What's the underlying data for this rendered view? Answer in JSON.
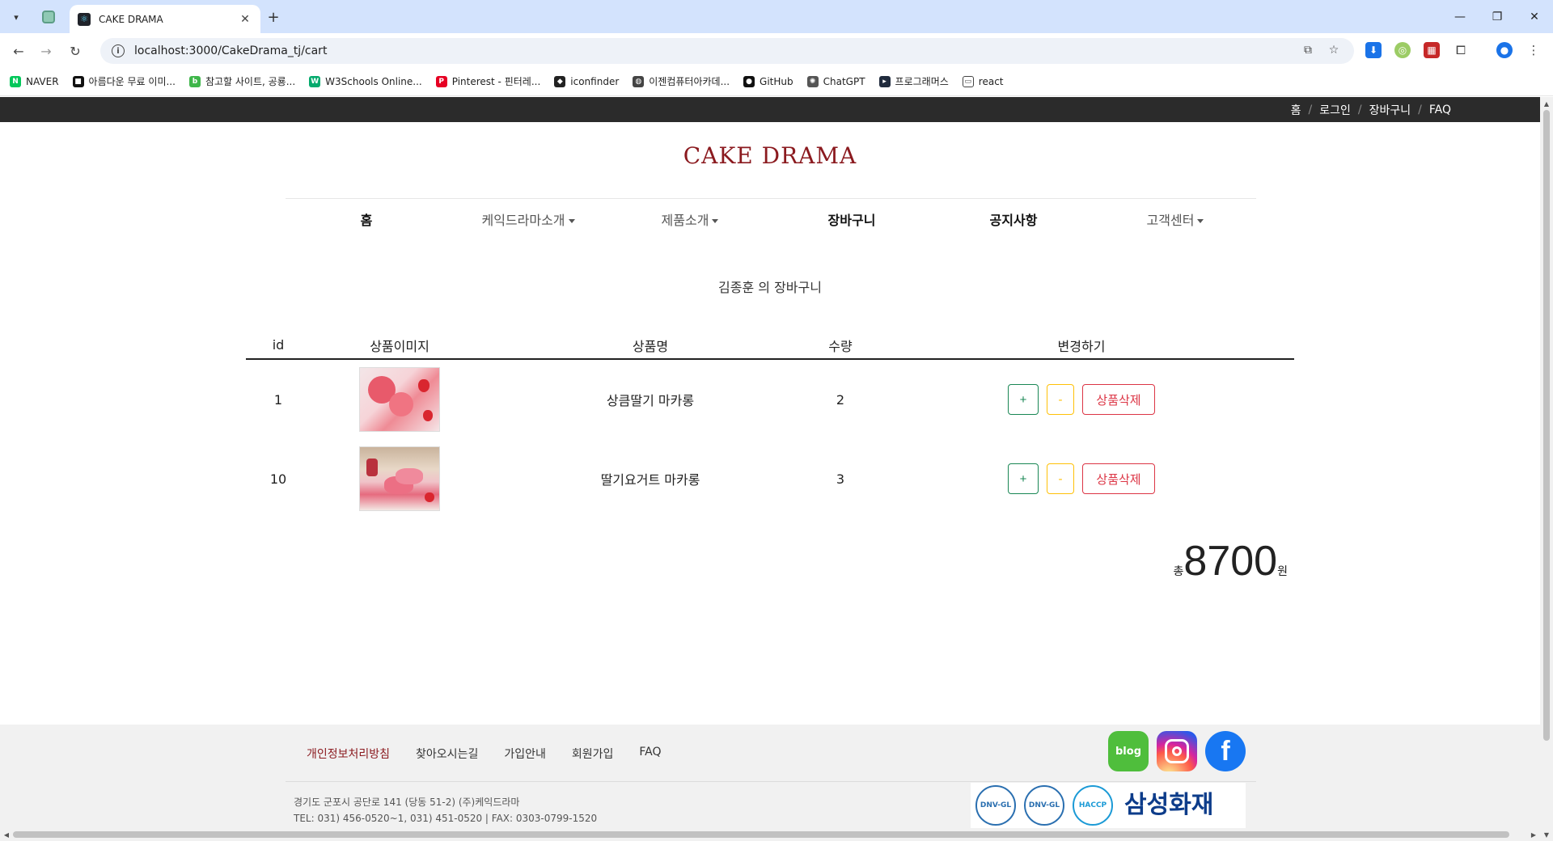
{
  "browser": {
    "tab_title": "CAKE DRAMA",
    "url": "localhost:3000/CakeDrama_tj/cart",
    "bookmarks": [
      {
        "label": "NAVER",
        "icon": "naver-icon",
        "color": "#03c75a"
      },
      {
        "label": "아름다운 무료 이미...",
        "icon": "unsplash-icon",
        "color": "#111111"
      },
      {
        "label": "참고할 사이트, 공룡...",
        "icon": "blog-icon",
        "color": "#3fb64a"
      },
      {
        "label": "W3Schools Online...",
        "icon": "w3schools-icon",
        "color": "#04aa6d"
      },
      {
        "label": "Pinterest - 핀터레...",
        "icon": "pinterest-icon",
        "color": "#e60023"
      },
      {
        "label": "iconfinder",
        "icon": "iconfinder-icon",
        "color": "#222222"
      },
      {
        "label": "이젠컴퓨터아카데...",
        "icon": "globe-icon",
        "color": "#444444"
      },
      {
        "label": "GitHub",
        "icon": "github-icon",
        "color": "#111111"
      },
      {
        "label": "ChatGPT",
        "icon": "chatgpt-icon",
        "color": "#555555"
      },
      {
        "label": "프로그래머스",
        "icon": "programmers-icon",
        "color": "#202b3d"
      },
      {
        "label": "react",
        "icon": "folder-icon",
        "color": "#ffffff"
      }
    ]
  },
  "topbar": {
    "links": [
      "홈",
      "로그인",
      "장바구니",
      "FAQ"
    ]
  },
  "site": {
    "logo": "CAKE DRAMA"
  },
  "nav": {
    "items": [
      {
        "label": "홈",
        "dropdown": false,
        "bold": true
      },
      {
        "label": "케익드라마소개",
        "dropdown": true,
        "bold": false
      },
      {
        "label": "제품소개",
        "dropdown": true,
        "bold": false
      },
      {
        "label": "장바구니",
        "dropdown": false,
        "bold": true
      },
      {
        "label": "공지사항",
        "dropdown": false,
        "bold": true
      },
      {
        "label": "고객센터",
        "dropdown": true,
        "bold": false
      }
    ]
  },
  "cart": {
    "title": "김종훈 의 장바구니",
    "headers": {
      "id": "id",
      "image": "상품이미지",
      "name": "상품명",
      "qty": "수량",
      "actions": "변경하기"
    },
    "rows": [
      {
        "id": "1",
        "name": "상큼딸기 마카롱",
        "qty": "2"
      },
      {
        "id": "10",
        "name": "딸기요거트 마카롱",
        "qty": "3"
      }
    ],
    "buttons": {
      "plus": "+",
      "minus": "-",
      "delete": "상품삭제"
    },
    "total": {
      "prefix": "총",
      "amount": "8700",
      "suffix": "원"
    }
  },
  "footer": {
    "links": [
      "개인정보처리방침",
      "찾아오시는길",
      "가입안내",
      "회원가입",
      "FAQ"
    ],
    "social": {
      "blog": "blog",
      "facebook": "f"
    },
    "address": "경기도 군포시 공단로 141 (당동 51-2) (주)케익드라마",
    "tel": "TEL: 031) 456-0520~1, 031) 451-0520  |  FAX: 0303-0799-1520",
    "badges": [
      "DNV-GL",
      "DNV-GL",
      "HACCP"
    ],
    "insurer": "삼성화재"
  },
  "colors": {
    "brand": "#8b1a1f",
    "topbar": "#2b2b2b",
    "success": "#198754",
    "warning": "#ffc107",
    "danger": "#dc3545"
  }
}
